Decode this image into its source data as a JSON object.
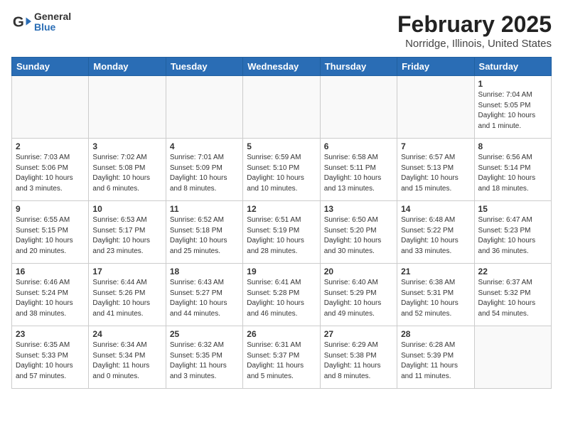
{
  "header": {
    "logo_line1": "General",
    "logo_line2": "Blue",
    "title": "February 2025",
    "subtitle": "Norridge, Illinois, United States"
  },
  "calendar": {
    "days_of_week": [
      "Sunday",
      "Monday",
      "Tuesday",
      "Wednesday",
      "Thursday",
      "Friday",
      "Saturday"
    ],
    "weeks": [
      [
        {
          "day": "",
          "info": ""
        },
        {
          "day": "",
          "info": ""
        },
        {
          "day": "",
          "info": ""
        },
        {
          "day": "",
          "info": ""
        },
        {
          "day": "",
          "info": ""
        },
        {
          "day": "",
          "info": ""
        },
        {
          "day": "1",
          "info": "Sunrise: 7:04 AM\nSunset: 5:05 PM\nDaylight: 10 hours\nand 1 minute."
        }
      ],
      [
        {
          "day": "2",
          "info": "Sunrise: 7:03 AM\nSunset: 5:06 PM\nDaylight: 10 hours\nand 3 minutes."
        },
        {
          "day": "3",
          "info": "Sunrise: 7:02 AM\nSunset: 5:08 PM\nDaylight: 10 hours\nand 6 minutes."
        },
        {
          "day": "4",
          "info": "Sunrise: 7:01 AM\nSunset: 5:09 PM\nDaylight: 10 hours\nand 8 minutes."
        },
        {
          "day": "5",
          "info": "Sunrise: 6:59 AM\nSunset: 5:10 PM\nDaylight: 10 hours\nand 10 minutes."
        },
        {
          "day": "6",
          "info": "Sunrise: 6:58 AM\nSunset: 5:11 PM\nDaylight: 10 hours\nand 13 minutes."
        },
        {
          "day": "7",
          "info": "Sunrise: 6:57 AM\nSunset: 5:13 PM\nDaylight: 10 hours\nand 15 minutes."
        },
        {
          "day": "8",
          "info": "Sunrise: 6:56 AM\nSunset: 5:14 PM\nDaylight: 10 hours\nand 18 minutes."
        }
      ],
      [
        {
          "day": "9",
          "info": "Sunrise: 6:55 AM\nSunset: 5:15 PM\nDaylight: 10 hours\nand 20 minutes."
        },
        {
          "day": "10",
          "info": "Sunrise: 6:53 AM\nSunset: 5:17 PM\nDaylight: 10 hours\nand 23 minutes."
        },
        {
          "day": "11",
          "info": "Sunrise: 6:52 AM\nSunset: 5:18 PM\nDaylight: 10 hours\nand 25 minutes."
        },
        {
          "day": "12",
          "info": "Sunrise: 6:51 AM\nSunset: 5:19 PM\nDaylight: 10 hours\nand 28 minutes."
        },
        {
          "day": "13",
          "info": "Sunrise: 6:50 AM\nSunset: 5:20 PM\nDaylight: 10 hours\nand 30 minutes."
        },
        {
          "day": "14",
          "info": "Sunrise: 6:48 AM\nSunset: 5:22 PM\nDaylight: 10 hours\nand 33 minutes."
        },
        {
          "day": "15",
          "info": "Sunrise: 6:47 AM\nSunset: 5:23 PM\nDaylight: 10 hours\nand 36 minutes."
        }
      ],
      [
        {
          "day": "16",
          "info": "Sunrise: 6:46 AM\nSunset: 5:24 PM\nDaylight: 10 hours\nand 38 minutes."
        },
        {
          "day": "17",
          "info": "Sunrise: 6:44 AM\nSunset: 5:26 PM\nDaylight: 10 hours\nand 41 minutes."
        },
        {
          "day": "18",
          "info": "Sunrise: 6:43 AM\nSunset: 5:27 PM\nDaylight: 10 hours\nand 44 minutes."
        },
        {
          "day": "19",
          "info": "Sunrise: 6:41 AM\nSunset: 5:28 PM\nDaylight: 10 hours\nand 46 minutes."
        },
        {
          "day": "20",
          "info": "Sunrise: 6:40 AM\nSunset: 5:29 PM\nDaylight: 10 hours\nand 49 minutes."
        },
        {
          "day": "21",
          "info": "Sunrise: 6:38 AM\nSunset: 5:31 PM\nDaylight: 10 hours\nand 52 minutes."
        },
        {
          "day": "22",
          "info": "Sunrise: 6:37 AM\nSunset: 5:32 PM\nDaylight: 10 hours\nand 54 minutes."
        }
      ],
      [
        {
          "day": "23",
          "info": "Sunrise: 6:35 AM\nSunset: 5:33 PM\nDaylight: 10 hours\nand 57 minutes."
        },
        {
          "day": "24",
          "info": "Sunrise: 6:34 AM\nSunset: 5:34 PM\nDaylight: 11 hours\nand 0 minutes."
        },
        {
          "day": "25",
          "info": "Sunrise: 6:32 AM\nSunset: 5:35 PM\nDaylight: 11 hours\nand 3 minutes."
        },
        {
          "day": "26",
          "info": "Sunrise: 6:31 AM\nSunset: 5:37 PM\nDaylight: 11 hours\nand 5 minutes."
        },
        {
          "day": "27",
          "info": "Sunrise: 6:29 AM\nSunset: 5:38 PM\nDaylight: 11 hours\nand 8 minutes."
        },
        {
          "day": "28",
          "info": "Sunrise: 6:28 AM\nSunset: 5:39 PM\nDaylight: 11 hours\nand 11 minutes."
        },
        {
          "day": "",
          "info": ""
        }
      ]
    ]
  }
}
